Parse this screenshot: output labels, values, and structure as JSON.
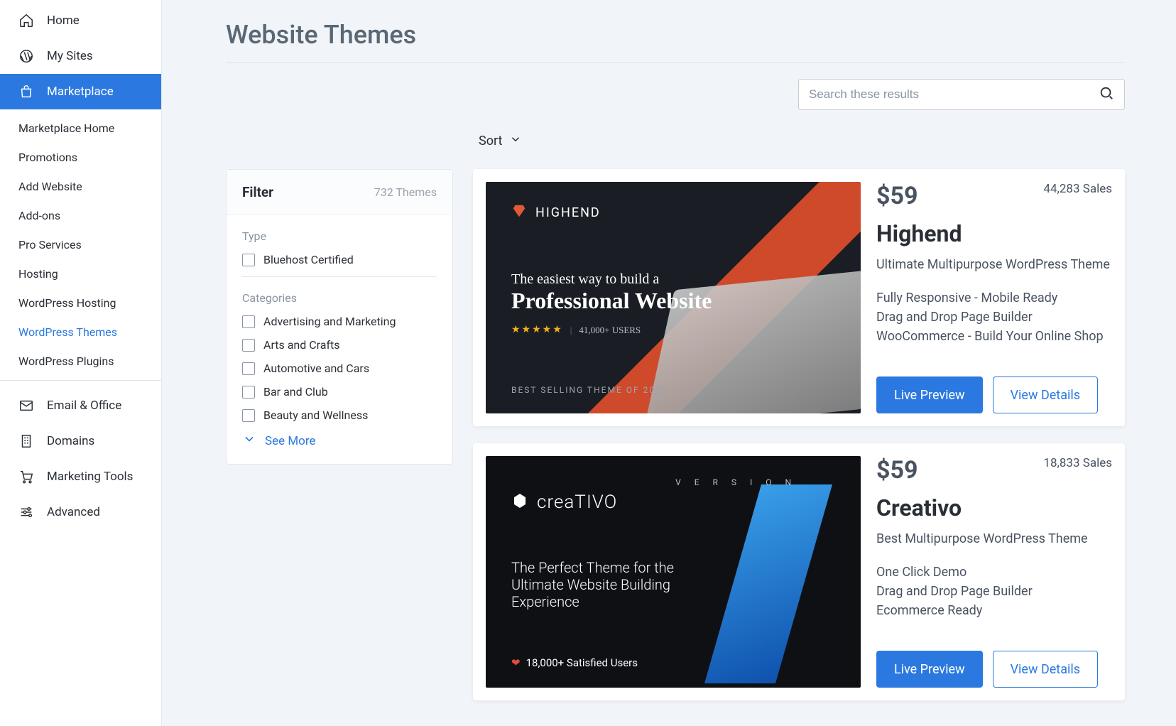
{
  "sidebar": {
    "main": [
      {
        "id": "home",
        "label": "Home",
        "icon": "home-icon"
      },
      {
        "id": "my-sites",
        "label": "My Sites",
        "icon": "wordpress-icon"
      },
      {
        "id": "marketplace",
        "label": "Marketplace",
        "icon": "bag-icon",
        "active": true
      },
      {
        "id": "email",
        "label": "Email & Office",
        "icon": "mail-icon"
      },
      {
        "id": "domains",
        "label": "Domains",
        "icon": "building-icon"
      },
      {
        "id": "marketing",
        "label": "Marketing Tools",
        "icon": "cart-icon"
      },
      {
        "id": "advanced",
        "label": "Advanced",
        "icon": "sliders-icon"
      }
    ],
    "marketplace_sub": [
      "Marketplace Home",
      "Promotions",
      "Add Website",
      "Add-ons",
      "Pro Services",
      "Hosting",
      "WordPress Hosting",
      "WordPress Themes",
      "WordPress Plugins"
    ],
    "marketplace_selected": "WordPress Themes"
  },
  "page": {
    "title": "Website Themes",
    "search_placeholder": "Search these results",
    "sort_label": "Sort"
  },
  "filter": {
    "title": "Filter",
    "count_label": "732 Themes",
    "type_title": "Type",
    "type_options": [
      "Bluehost Certified"
    ],
    "cat_title": "Categories",
    "categories": [
      "Advertising and Marketing",
      "Arts and Crafts",
      "Automotive and Cars",
      "Bar and Club",
      "Beauty and Wellness"
    ],
    "see_more": "See More"
  },
  "buttons": {
    "live_preview": "Live Preview",
    "view_details": "View Details"
  },
  "themes": [
    {
      "id": "highend",
      "price": "$59",
      "sales": "44,283 Sales",
      "name": "Highend",
      "tagline": "Ultimate Multipurpose WordPress Theme",
      "features": [
        "Fully Responsive - Mobile Ready",
        "Drag and Drop Page Builder",
        "WooCommerce - Build Your Online Shop"
      ],
      "thumb": {
        "brand": "HIGHEND",
        "sub": "The easiest way to build a",
        "big": "Professional Website",
        "stars_note": "41,000+ USERS",
        "foot": "BEST SELLING THEME OF 2020"
      }
    },
    {
      "id": "creativo",
      "price": "$59",
      "sales": "18,833 Sales",
      "name": "Creativo",
      "tagline": "Best Multipurpose WordPress Theme",
      "features": [
        "One Click Demo",
        "Drag and Drop Page Builder",
        "Ecommerce Ready"
      ],
      "thumb": {
        "brand": "creaTIVO",
        "version": "V E R S I O N",
        "sub": "The Perfect Theme for the",
        "sub2": "Ultimate Website Building",
        "sub3": "Experience",
        "heart": "18,000+ Satisfied Users"
      }
    }
  ]
}
